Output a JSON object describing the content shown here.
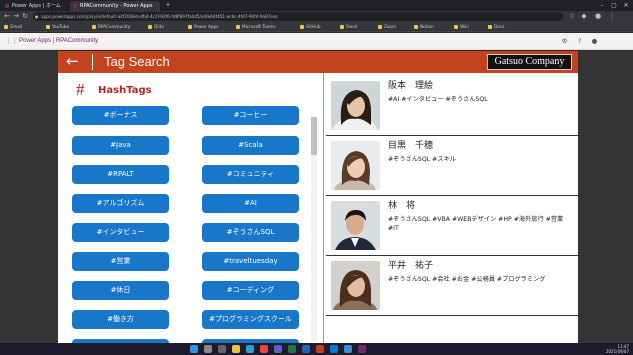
{
  "browser": {
    "tabs": [
      {
        "label": "Power Apps | ホーム",
        "active": false
      },
      {
        "label": "RPACommunity - Power Apps",
        "active": true
      }
    ],
    "new_tab": "+",
    "url": "apps.powerapps.com/play/e/default-a4f2008d-afbd-4c1f-92f6-fd8f897fa4d5/a/8e64f451-acbc-4fd7-90fd-9a87eac",
    "bookmarks": [
      "Gmail",
      "YouTube",
      "RPACommunity",
      "Qiita",
      "Power Apps",
      "Microsoft Teams",
      "GitHub",
      "Slack",
      "Zoom",
      "Notion",
      "Wiki",
      "Docs"
    ]
  },
  "powerapps_bar": {
    "title": "Power Apps | RPACommunity"
  },
  "app": {
    "header": {
      "back_symbol": "←",
      "title": "Tag Search",
      "brand": "Gatsuo Company"
    },
    "hashtags": {
      "symbol": "#",
      "label": "HashTags",
      "tags": [
        "#ボーナス",
        "#コーヒー",
        "#Java",
        "#Scala",
        "#RPALT",
        "#コミュニティ",
        "#アルゴリズム",
        "#AI",
        "#インタビュー",
        "#ぞうさんSQL",
        "#営業",
        "#traveltuesday",
        "#休日",
        "#コーディング",
        "#働き方",
        "#プログラミングスクール"
      ]
    },
    "people": [
      {
        "name": "阪本　理絵",
        "tags": "#AI #インタビュー #ぞうさんSQL"
      },
      {
        "name": "目黒　千穂",
        "tags": "#ぞうさんSQL #スキル"
      },
      {
        "name": "林　将",
        "tags": "#ぞうさんSQL #VBA #WEBデザイン #HP #海外旅行 #営業 #IT"
      },
      {
        "name": "平井　祐子",
        "tags": "#ぞうさんSQL #会社 #お金 #公務員 #プログラミング"
      }
    ]
  },
  "taskbar": {
    "time": "11:47",
    "date": "2021/09/07"
  },
  "colors": {
    "header": "#c2431d",
    "tag_button": "#1877c9",
    "hashtag_text": "#b3261e"
  }
}
